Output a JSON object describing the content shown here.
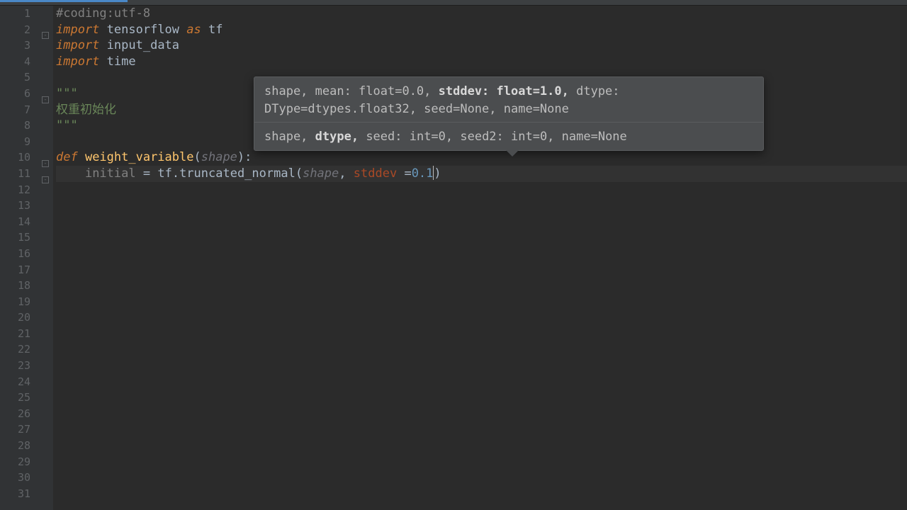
{
  "tabs": {
    "active": true
  },
  "lines": {
    "l1_comment": "#coding:utf-8",
    "l2_kw": "import",
    "l2_mod": "tensorflow",
    "l2_as": "as",
    "l2_alias": "tf",
    "l3_kw": "import",
    "l3_mod": "input_data",
    "l4_kw": "import",
    "l4_mod": "time",
    "l6_str": "\"\"\"",
    "l7_str": "权重初始化",
    "l8_str": "\"\"\"",
    "l10_def": "def ",
    "l10_fn": "weight_variable",
    "l10_op1": "(",
    "l10_param": "shape",
    "l10_op2": "):",
    "l11_indent": "    ",
    "l11_var": "initial",
    "l11_eq": " = ",
    "l11_mod": "tf",
    "l11_dot": ".",
    "l11_call": "truncated_normal",
    "l11_open": "(",
    "l11_arg1": "shape",
    "l11_comma1": ",",
    "l11_sp1": " ",
    "l11_kwarg": "stddev",
    "l11_sp2": " ",
    "l11_eq2": "=",
    "l11_val": "0.1",
    "l11_close": ")"
  },
  "popup": {
    "row1_pre": "shape, mean: float=0.0, ",
    "row1_bold": "stddev: float=1.0,",
    "row1_post": " dtype: DType=dtypes.float32, seed=None, name=None",
    "row2_pre": "shape, ",
    "row2_bold": "dtype,",
    "row2_post": " seed: int=0, seed2: int=0, name=None"
  },
  "gutter": {
    "count": 31
  }
}
